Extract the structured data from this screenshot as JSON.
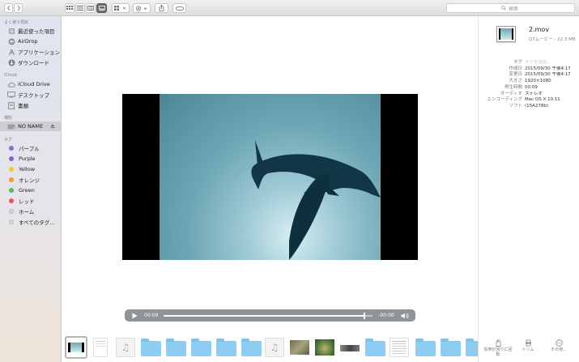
{
  "toolbar": {
    "search_placeholder": "検索",
    "buttons": [
      "back",
      "forward",
      "icon-view",
      "list-view",
      "column-view",
      "gallery-view",
      "group-by",
      "action",
      "share",
      "tags"
    ]
  },
  "sidebar": {
    "favorites_header": "よく使う項目",
    "favorites": [
      {
        "label": "最近使った項目",
        "icon": "recents-icon"
      },
      {
        "label": "AirDrop",
        "icon": "airdrop-icon"
      },
      {
        "label": "アプリケーション",
        "icon": "applications-icon"
      },
      {
        "label": "ダウンロード",
        "icon": "downloads-icon"
      }
    ],
    "icloud_header": "iCloud",
    "icloud": [
      {
        "label": "iCloud Drive",
        "icon": "cloud-icon"
      },
      {
        "label": "デスクトップ",
        "icon": "desktop-icon"
      },
      {
        "label": "書類",
        "icon": "documents-icon"
      }
    ],
    "locations_header": "場所",
    "locations": [
      {
        "label": "NO NAME",
        "icon": "drive-icon",
        "selected": true
      }
    ],
    "tags_header": "タグ",
    "tags": [
      {
        "label": "パープル",
        "color": "#8a6bd1"
      },
      {
        "label": "Purple",
        "color": "#7e62d6"
      },
      {
        "label": "Yellow",
        "color": "#f5c926"
      },
      {
        "label": "オレンジ",
        "color": "#f29b38"
      },
      {
        "label": "Green",
        "color": "#4cc05e"
      },
      {
        "label": "レッド",
        "color": "#ec5652"
      },
      {
        "label": "ホーム",
        "color": "#d9d6d2"
      },
      {
        "label": "すべてのタグ...",
        "color": "#d9d6d2"
      }
    ]
  },
  "player": {
    "elapsed": "00:09",
    "remaining": "-00:00",
    "progress": 0.96
  },
  "info": {
    "file_name": "2.mov",
    "file_kind": "QTムービー - 22.3 MB",
    "rows": [
      {
        "key": "タグ",
        "value": "タグを追加..."
      },
      {
        "key": "作成日",
        "value": "2015/09/30 午後4:17"
      },
      {
        "key": "変更日",
        "value": "2015/09/30 午後4:17"
      },
      {
        "key": "大きさ",
        "value": "1920×1080"
      },
      {
        "key": "再生時間",
        "value": "00:09"
      },
      {
        "key": "オーディオ",
        "value": "ステレオ"
      },
      {
        "key": "エンコーディング",
        "value": "Mac OS X 10.11"
      },
      {
        "key": "ソフト",
        "value": "(15A278b)"
      }
    ],
    "actions": [
      {
        "label": "反時計回りに回転",
        "icon": "rotate-left-icon"
      },
      {
        "label": "トリム",
        "icon": "trim-icon"
      },
      {
        "label": "その他...",
        "icon": "more-icon"
      }
    ]
  },
  "filmstrip": [
    "video",
    "document",
    "music",
    "folder",
    "folder",
    "folder",
    "folder",
    "folder",
    "music",
    "photo",
    "photo",
    "photo",
    "folder",
    "document",
    "folder",
    "folder",
    "folder"
  ]
}
